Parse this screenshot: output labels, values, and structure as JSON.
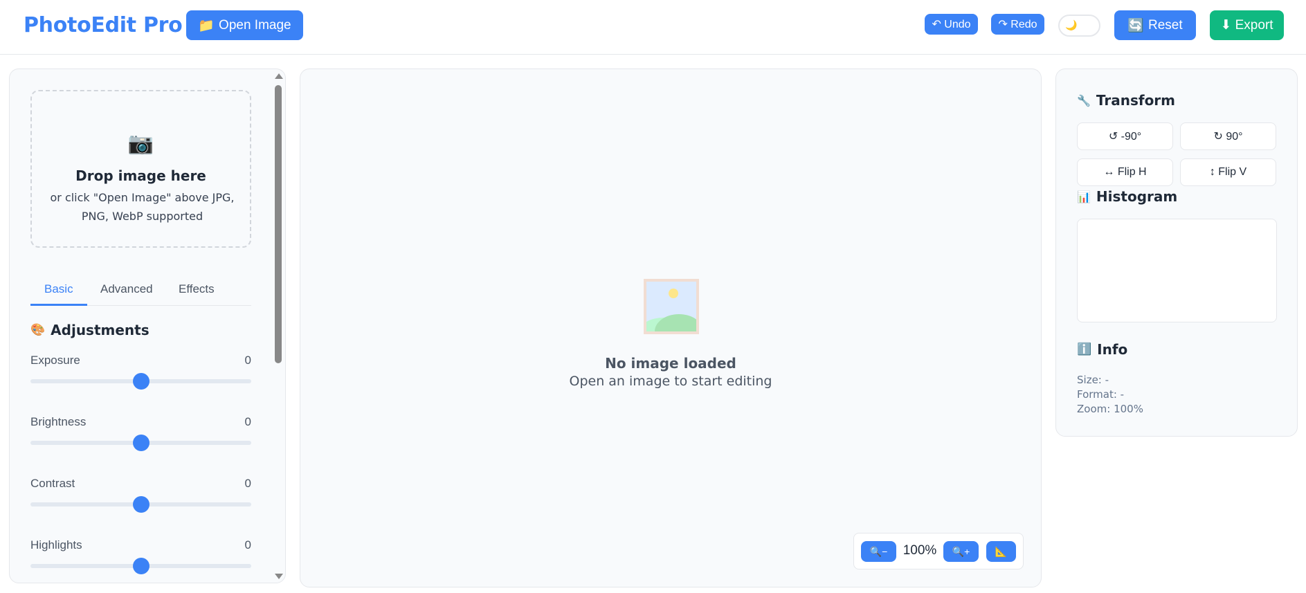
{
  "header": {
    "brand": "PhotoEdit Pro",
    "open_label": "Open Image",
    "open_icon": "📁",
    "undo_label": "↶ Undo",
    "redo_label": "↷ Redo",
    "theme_icon": "🌙",
    "reset_label": "Reset",
    "reset_icon": "🔄",
    "export_label": "⬇ Export"
  },
  "dropzone": {
    "icon": "📷",
    "title": "Drop image here",
    "subtitle": "or click \"Open Image\" above JPG, PNG, WebP supported"
  },
  "tabs": [
    {
      "label": "Basic",
      "active": true
    },
    {
      "label": "Advanced",
      "active": false
    },
    {
      "label": "Effects",
      "active": false
    }
  ],
  "adjustments": {
    "icon": "🎨",
    "title": "Adjustments",
    "sliders": [
      {
        "label": "Exposure",
        "value": "0",
        "fraction": 0.5
      },
      {
        "label": "Brightness",
        "value": "0",
        "fraction": 0.5
      },
      {
        "label": "Contrast",
        "value": "0",
        "fraction": 0.5
      },
      {
        "label": "Highlights",
        "value": "0",
        "fraction": 0.5
      }
    ]
  },
  "canvas": {
    "empty_title": "No image loaded",
    "empty_subtitle": "Open an image to start editing",
    "zoom_out_label": "🔍−",
    "zoom_value": "100%",
    "zoom_in_label": "🔍+",
    "fit_label": "📐"
  },
  "transform": {
    "icon": "🔧",
    "title": "Transform",
    "rotate_left": "↺ -90°",
    "rotate_right": "↻ 90°",
    "flip_h": "↔ Flip H",
    "flip_v": "↕ Flip V"
  },
  "histogram": {
    "icon": "📊",
    "title": "Histogram"
  },
  "info": {
    "icon": "ℹ️",
    "title": "Info",
    "size": "Size: -",
    "format": "Format: -",
    "zoom": "Zoom: 100%"
  },
  "colors": {
    "accent": "#3b82f6",
    "export": "#10b981"
  }
}
